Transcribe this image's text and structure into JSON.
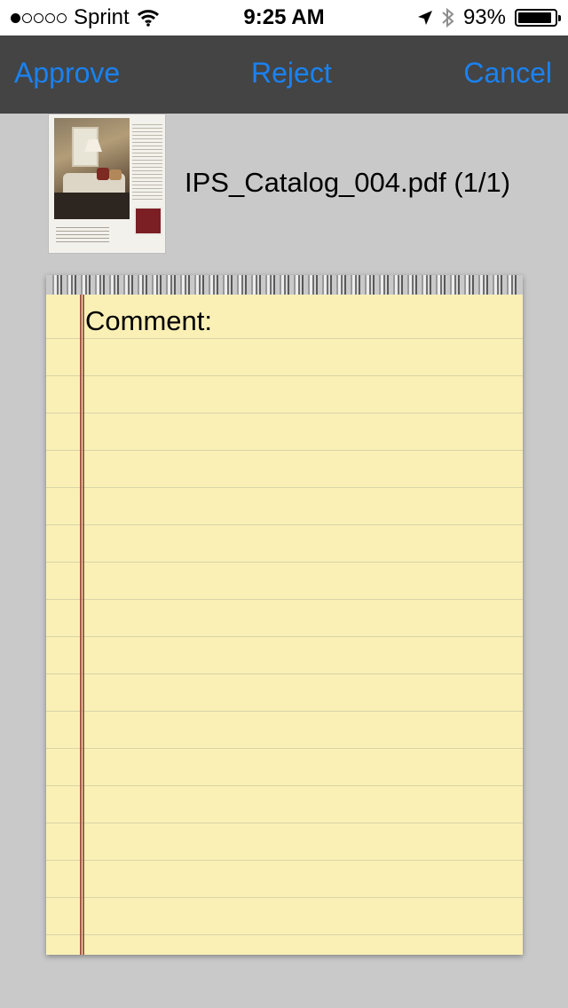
{
  "status_bar": {
    "carrier": "Sprint",
    "signal_strength": 1,
    "signal_max": 5,
    "time": "9:25 AM",
    "battery": "93%",
    "battery_level": 0.93,
    "icons": [
      "wifi-icon",
      "location-arrow-icon",
      "bluetooth-icon",
      "battery-icon"
    ]
  },
  "toolbar": {
    "approve_label": "Approve",
    "reject_label": "Reject",
    "cancel_label": "Cancel",
    "accent_color": "#1a82f2"
  },
  "document": {
    "file_name": "IPS_Catalog_004.pdf (1/1)"
  },
  "comment": {
    "label": "Comment:",
    "value": ""
  }
}
